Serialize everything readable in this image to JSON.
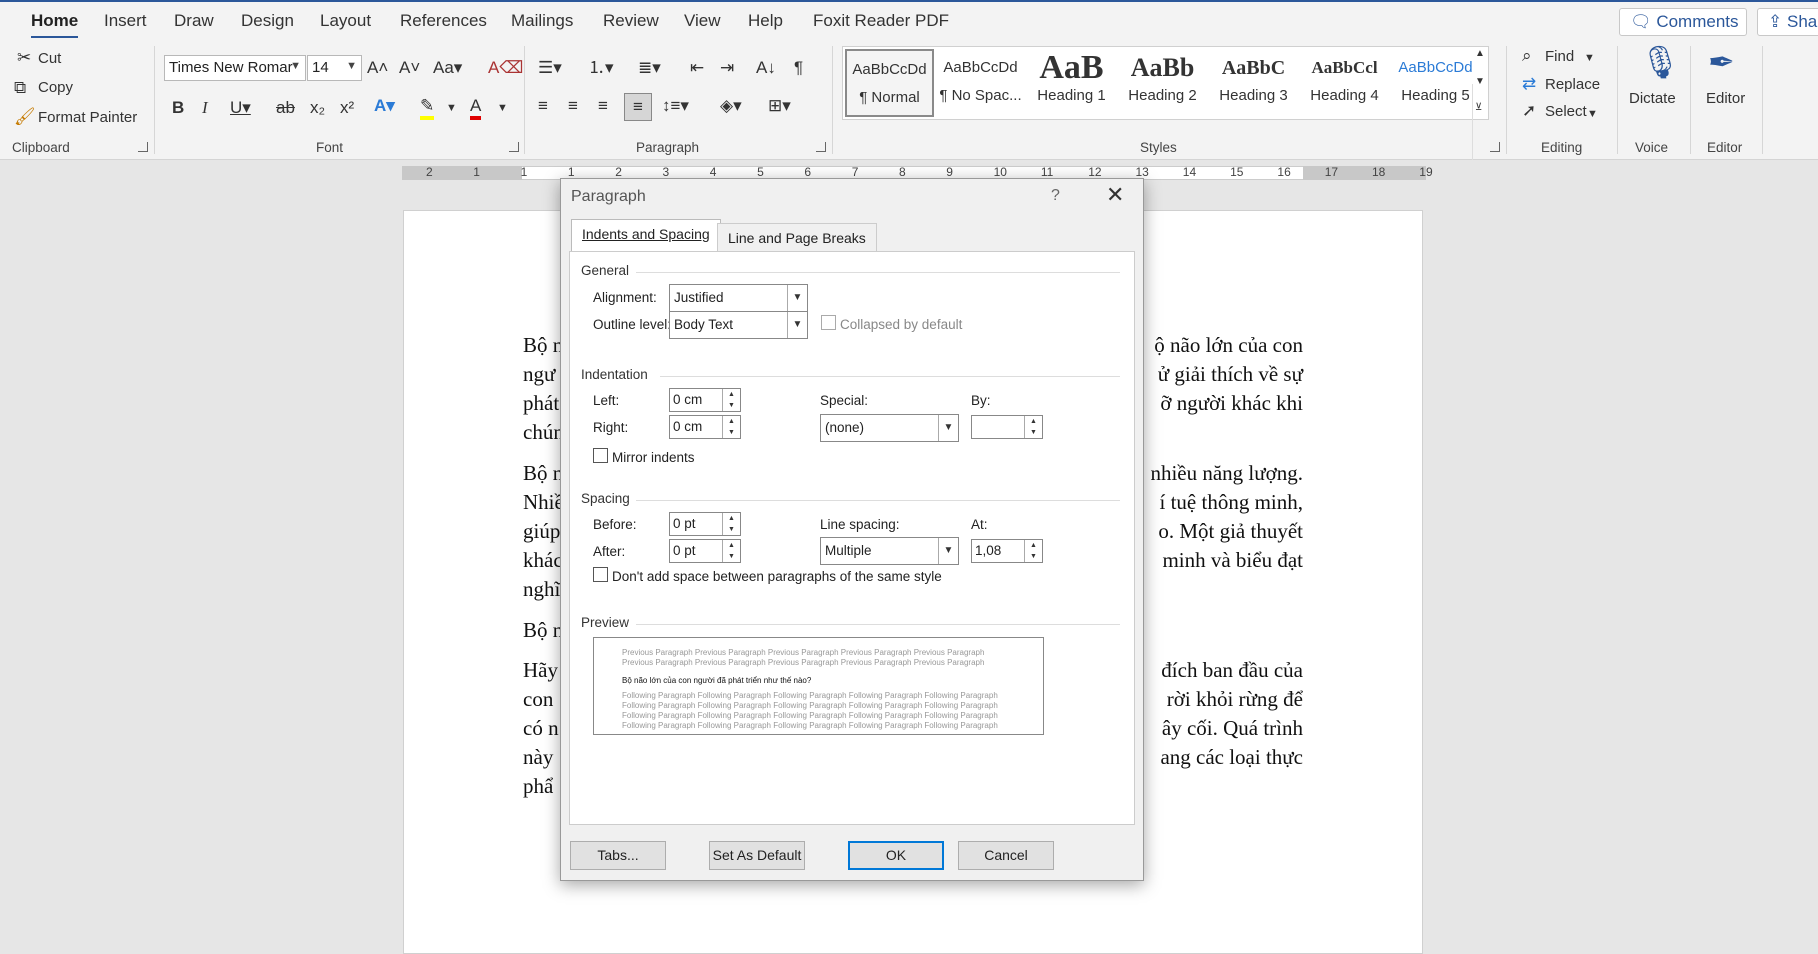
{
  "menu_tabs": [
    "Home",
    "Insert",
    "Draw",
    "Design",
    "Layout",
    "References",
    "Mailings",
    "Review",
    "View",
    "Help",
    "Foxit Reader PDF"
  ],
  "top_buttons": {
    "comments": "Comments",
    "share": "Shar"
  },
  "clipboard": {
    "cut": "Cut",
    "copy": "Copy",
    "format_painter": "Format Painter",
    "label": "Clipboard"
  },
  "font": {
    "name": "Times New Romar",
    "size": "14",
    "label": "Font"
  },
  "paragraph_group": {
    "label": "Paragraph"
  },
  "styles": {
    "label": "Styles",
    "items": [
      {
        "preview": "AaBbCcDd",
        "name": "¶ Normal"
      },
      {
        "preview": "AaBbCcDd",
        "name": "¶ No Spac..."
      },
      {
        "preview": "AaB",
        "name": "Heading 1"
      },
      {
        "preview": "AaBb",
        "name": "Heading 2"
      },
      {
        "preview": "AaBbC",
        "name": "Heading 3"
      },
      {
        "preview": "AaBbCcl",
        "name": "Heading 4"
      },
      {
        "preview": "AaBbCcDd",
        "name": "Heading 5"
      }
    ]
  },
  "editing": {
    "find": "Find",
    "replace": "Replace",
    "select": "Select",
    "label": "Editing"
  },
  "voice": {
    "dictate": "Dictate",
    "label": "Voice"
  },
  "editor": {
    "editor": "Editor",
    "label": "Editor"
  },
  "ruler": {
    "numbers": [
      "2",
      "1",
      "1",
      "1",
      "2",
      "3",
      "4",
      "5",
      "6",
      "7",
      "8",
      "9",
      "10",
      "11",
      "12",
      "13",
      "14",
      "15",
      "16",
      "17",
      "18",
      "19"
    ]
  },
  "document": {
    "lines_left": [
      "Bộ n",
      "ngư",
      "phát",
      "chún",
      "Bộ n",
      "Nhiề",
      "giúp",
      "khác",
      "nghĩ",
      "Bộ n",
      "Hãy",
      "con",
      "có n",
      "này",
      "phẩ"
    ],
    "lines_right": [
      "ộ não lớn của con",
      "ử giải thích về sự",
      "ỡ người khác khi",
      "",
      "nhiều năng lượng.",
      "í tuệ thông minh,",
      "o. Một giả thuyết",
      "minh và biểu đạt",
      "",
      "",
      "đích ban đầu của",
      "rời khỏi rừng để",
      "ây cối. Quá trình",
      "ang các loại thực",
      ""
    ]
  },
  "dialog": {
    "title": "Paragraph",
    "help": "?",
    "close": "✕",
    "tabs": [
      "Indents and Spacing",
      "Line and Page Breaks"
    ],
    "general": {
      "header": "General",
      "alignment_label": "Alignment:",
      "alignment": "Justified",
      "outline_label": "Outline level:",
      "outline": "Body Text",
      "collapsed": "Collapsed by default"
    },
    "indentation": {
      "header": "Indentation",
      "left_label": "Left:",
      "left": "0 cm",
      "right_label": "Right:",
      "right": "0 cm",
      "special_label": "Special:",
      "special": "(none)",
      "by_label": "By:",
      "by": "",
      "mirror": "Mirror indents"
    },
    "spacing": {
      "header": "Spacing",
      "before_label": "Before:",
      "before": "0 pt",
      "after_label": "After:",
      "after": "0 pt",
      "line_label": "Line spacing:",
      "line": "Multiple",
      "at_label": "At:",
      "at": "1,08",
      "dont_add": "Don't add space between paragraphs of the same style"
    },
    "preview": {
      "header": "Preview",
      "prev": "Previous Paragraph Previous Paragraph Previous Paragraph Previous Paragraph Previous Paragraph Previous Paragraph Previous Paragraph Previous Paragraph Previous Paragraph Previous Paragraph",
      "main": "Bộ não lớn của con người đã phát triển như thế nào?",
      "next": "Following Paragraph Following Paragraph Following Paragraph Following Paragraph Following Paragraph Following Paragraph Following Paragraph Following Paragraph Following Paragraph Following Paragraph Following Paragraph Following Paragraph Following Paragraph Following Paragraph Following Paragraph Following Paragraph Following Paragraph Following Paragraph Following Paragraph Following Paragraph Following Paragraph Following Paragraph Following Paragraph Following Paragraph Following Paragraph Following Paragraph Following Paragraph Following Paragraph"
    },
    "buttons": {
      "tabs": "Tabs...",
      "default": "Set As Default",
      "ok": "OK",
      "cancel": "Cancel"
    }
  },
  "colors": {
    "accent": "#2b579a",
    "highlight": "#ffff00",
    "font_color": "#e00000"
  }
}
